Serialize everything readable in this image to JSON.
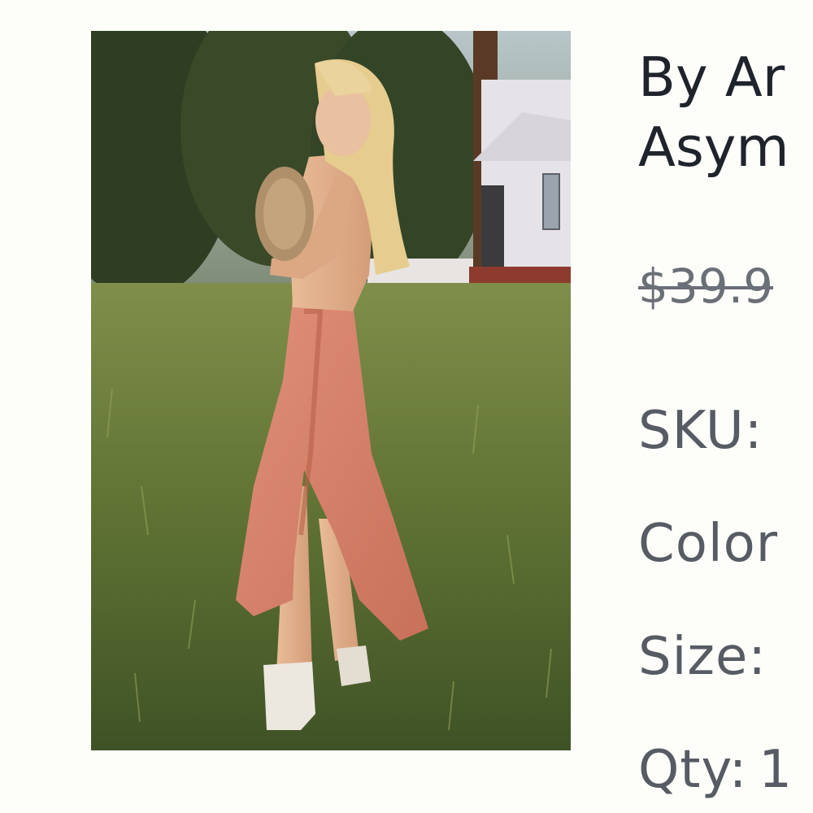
{
  "product": {
    "image_alt": "Model wearing coral asymmetric lace-trim slip skirt in a grassy field",
    "title_line1": "By Ar",
    "title_line2": "Asym",
    "price_original": "$39.9",
    "sku_label": "SKU:",
    "color_label": "Color",
    "size_label": "Size:",
    "qty_label": "Qty:",
    "qty_value": "1"
  },
  "colors": {
    "title": "#1f232c",
    "spec_text": "#575b64",
    "skirt": "#d98268",
    "background": "#fdfdf9"
  }
}
